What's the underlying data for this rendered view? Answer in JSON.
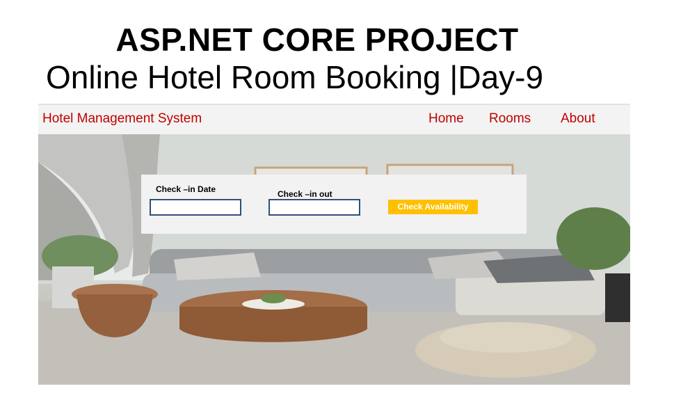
{
  "header": {
    "title": "ASP.NET CORE PROJECT",
    "subtitle": "Online Hotel Room Booking |Day-9"
  },
  "navbar": {
    "brand": "Hotel Management System",
    "links": [
      "Home",
      "Rooms",
      "About"
    ]
  },
  "booking": {
    "checkin_label": "Check –in Date",
    "checkout_label": "Check –in out",
    "checkin_value": "",
    "checkout_value": "",
    "button_label": "Check Availability"
  },
  "colors": {
    "accent": "#c00000",
    "button": "#ffc000",
    "field_border": "#2f4f7a"
  }
}
